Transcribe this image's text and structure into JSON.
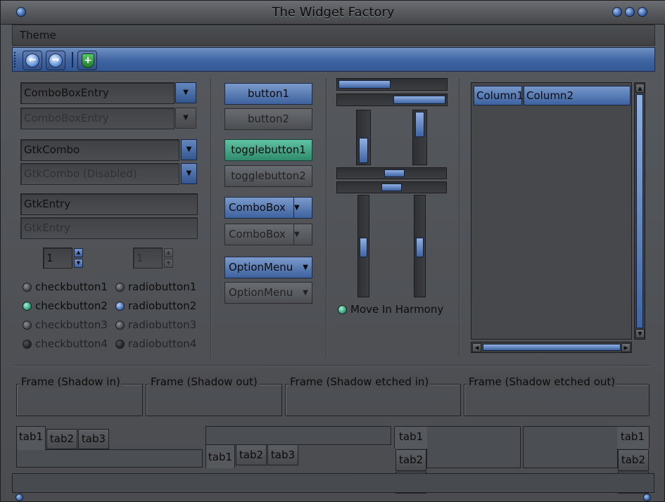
{
  "window": {
    "title": "The Widget Factory"
  },
  "menu": {
    "theme": "Theme"
  },
  "toolbar": {
    "back": "back",
    "forward": "forward",
    "shield": "security"
  },
  "col1": {
    "combo_entry": "ComboBoxEntry",
    "combo_entry_disabled": "ComboBoxEntry",
    "gtk_combo": "GtkCombo",
    "gtk_combo_disabled": "GtkCombo (Disabled)",
    "entry": "GtkEntry",
    "entry_disabled": "GtkEntry",
    "spin1": "1",
    "spin2": "1",
    "check1": "checkbutton1",
    "check2": "checkbutton2",
    "check3": "checkbutton3",
    "check4": "checkbutton4",
    "radio1": "radiobutton1",
    "radio2": "radiobutton2",
    "radio3": "radiobutton3",
    "radio4": "radiobutton4"
  },
  "col2": {
    "button1": "button1",
    "button2": "button2",
    "toggle1": "togglebutton1",
    "toggle2": "togglebutton2",
    "combobox": "ComboBox",
    "combobox_disabled": "ComboBox",
    "optionmenu": "OptionMenu",
    "optionmenu_disabled": "OptionMenu"
  },
  "col3": {
    "harmony": "Move In Harmony"
  },
  "tree": {
    "columns": [
      "Column1",
      "Column2"
    ]
  },
  "frames": [
    "Frame (Shadow in)",
    "Frame (Shadow out)",
    "Frame (Shadow etched in)",
    "Frame (Shadow etched out)"
  ],
  "notebooks": {
    "tabs": [
      "tab1",
      "tab2",
      "tab3"
    ]
  },
  "colors": {
    "accent": "#4a6ea9",
    "teal": "#2fa07a",
    "window": "#4b4d51"
  }
}
